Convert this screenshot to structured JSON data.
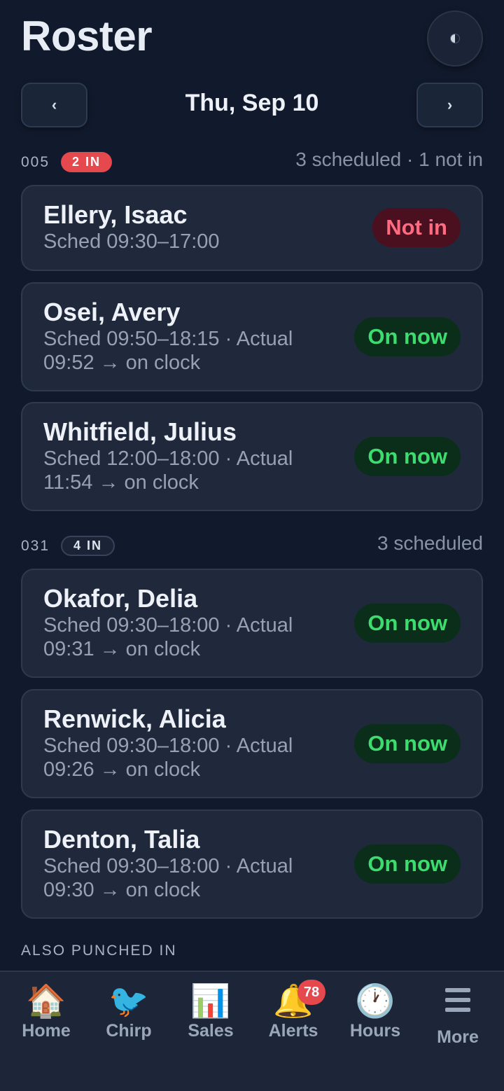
{
  "header": {
    "title": "Roster",
    "theme_icon": "half-moon-icon"
  },
  "date_nav": {
    "prev_label": "‹",
    "date": "Thu, Sep 10",
    "next_label": "›"
  },
  "groups": [
    {
      "code": "005",
      "badge": "2 IN",
      "summary": "3 scheduled · 1 not in",
      "employees": [
        {
          "name": "Ellery, Isaac",
          "schedule": "Sched 09:30–17:00",
          "status": "Not in"
        },
        {
          "name": "Osei, Avery",
          "schedule": "Sched 09:50–18:15 · Actual 09:52 → on clock",
          "status": "On now"
        },
        {
          "name": "Whitfield, Julius",
          "schedule": "Sched 12:00–18:00 · Actual 11:54 → on clock",
          "status": "On now"
        }
      ]
    },
    {
      "code": "031",
      "badge": "4 IN",
      "summary": "3 scheduled",
      "employees": [
        {
          "name": "Okafor, Delia",
          "schedule": "Sched 09:30–18:00 · Actual 09:31 → on clock",
          "status": "On now"
        },
        {
          "name": "Renwick, Alicia",
          "schedule": "Sched 09:30–18:00 · Actual 09:26 → on clock",
          "status": "On now"
        },
        {
          "name": "Denton, Talia",
          "schedule": "Sched 09:30–18:00 · Actual 09:30 → on clock",
          "status": "On now"
        }
      ]
    }
  ],
  "also_punched_in": "ALSO PUNCHED IN",
  "tabs": [
    {
      "label": "Home",
      "icon": "🏠"
    },
    {
      "label": "Chirp",
      "icon": "🐦"
    },
    {
      "label": "Sales",
      "icon": "📊"
    },
    {
      "label": "Alerts",
      "icon": "🔔",
      "badge": "78"
    },
    {
      "label": "Hours",
      "icon": "🕐"
    },
    {
      "label": "More",
      "icon": "menu-icon"
    }
  ],
  "colors": {
    "background": "#111a2c",
    "card": "#1f293b",
    "on_now": "#3ddc6e",
    "not_in": "#ff6b81",
    "badge_red": "#e5484d"
  }
}
